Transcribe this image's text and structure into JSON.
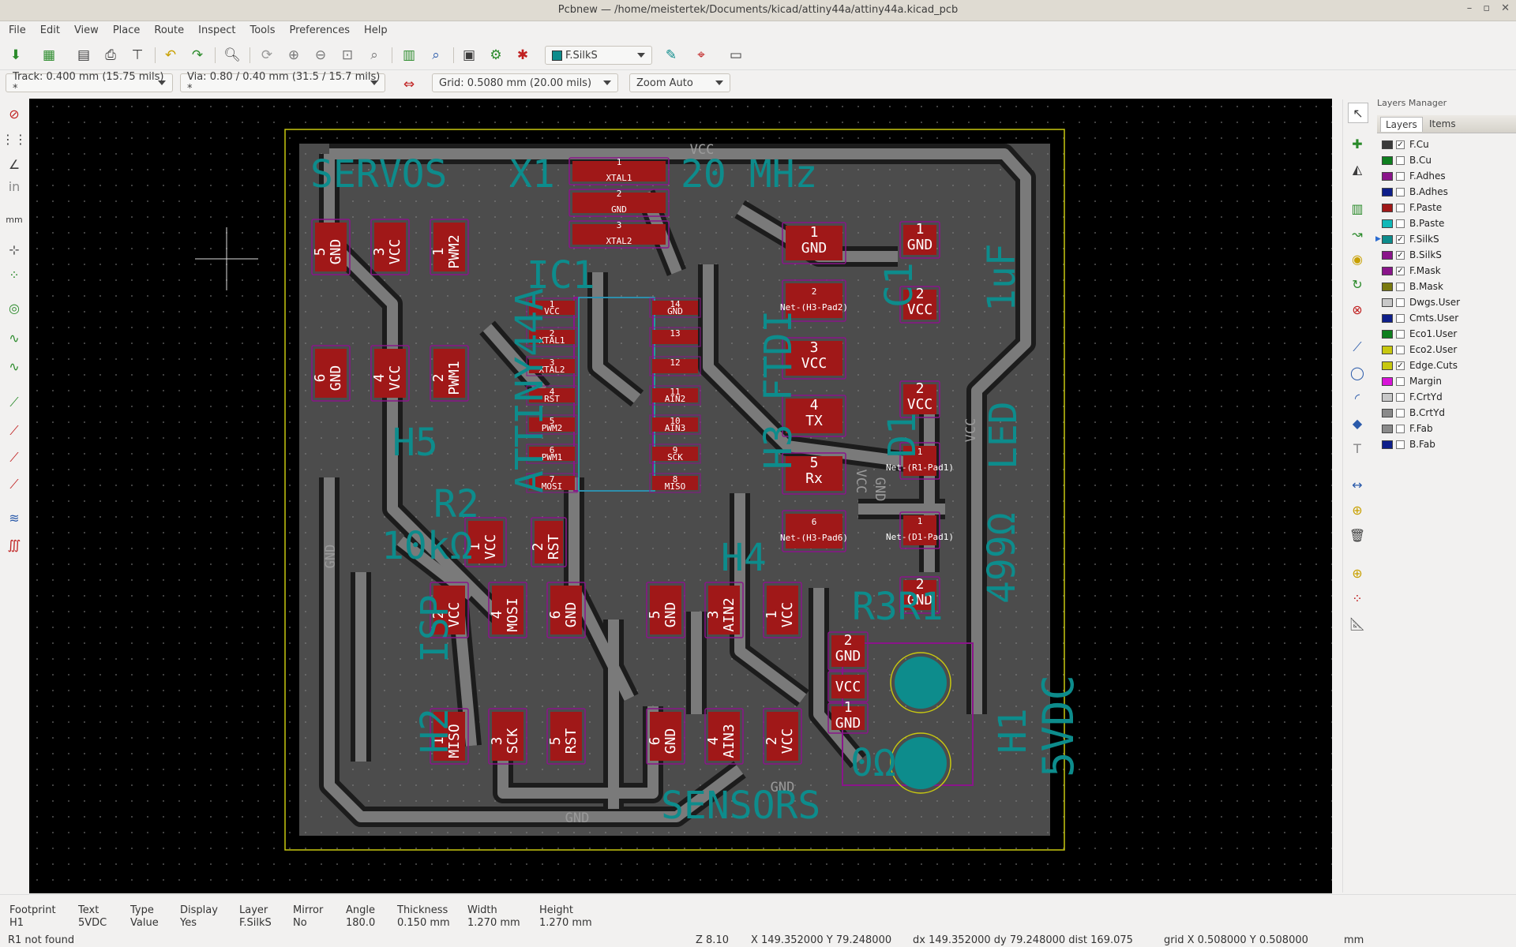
{
  "window": {
    "title": "Pcbnew — /home/meistertek/Documents/kicad/attiny44a/attiny44a.kicad_pcb",
    "min": "–",
    "max": "▫",
    "close": "✕"
  },
  "menu": [
    "File",
    "Edit",
    "View",
    "Place",
    "Route",
    "Inspect",
    "Tools",
    "Preferences",
    "Help"
  ],
  "toolbar": {
    "layer_select": "F.SilkS"
  },
  "options": {
    "track": "Track: 0.400 mm (15.75 mils) *",
    "via": "Via: 0.80 / 0.40 mm (31.5 / 15.7 mils) *",
    "grid": "Grid: 0.5080 mm (20.00 mils)",
    "zoom": "Zoom Auto"
  },
  "board": {
    "silkscreen": [
      "SERVOS",
      "X1",
      "20 MHz",
      "IC1",
      "ATTINY44A",
      "H3 FTDI",
      "C1",
      "1uF",
      "D1",
      "LED",
      "H5",
      "R2",
      "10kΩ",
      "ISP",
      "H2",
      "H4",
      "R3R1",
      "499Ω",
      "0Ω",
      "H1",
      "5VDC",
      "SENSORS"
    ],
    "copper_labels": [
      "VCC",
      "GND",
      "GND",
      "GND",
      "GND",
      "VCC",
      "VCC"
    ],
    "pads": [
      [
        "5",
        "GND"
      ],
      [
        "3",
        "VCC"
      ],
      [
        "1",
        "PWM2"
      ],
      [
        "6",
        "GND"
      ],
      [
        "4",
        "VCC"
      ],
      [
        "2",
        "PWM1"
      ],
      [
        "1",
        "XTAL1"
      ],
      [
        "2",
        "GND"
      ],
      [
        "3",
        "XTAL2"
      ],
      [
        "1",
        "GND"
      ],
      [
        "2",
        "Net-(H3-Pad2)"
      ],
      [
        "3",
        "VCC"
      ],
      [
        "4",
        "TX"
      ],
      [
        "5",
        "Rx"
      ],
      [
        "6",
        "Net-(H3-Pad6)"
      ],
      [
        "1",
        "GND"
      ],
      [
        "2",
        "VCC"
      ],
      [
        "2",
        "VCC"
      ],
      [
        "1",
        "Net-(R1-Pad1)"
      ],
      [
        "1",
        "Net-(D1-Pad1)"
      ],
      [
        "2",
        "GND"
      ],
      [
        "1",
        "VCC"
      ],
      [
        "2",
        "RST"
      ],
      [
        "2",
        "VCC"
      ],
      [
        "4",
        "MOSI"
      ],
      [
        "6",
        "GND"
      ],
      [
        "1",
        "MISO"
      ],
      [
        "3",
        "SCK"
      ],
      [
        "5",
        "RST"
      ],
      [
        "5",
        "GND"
      ],
      [
        "3",
        "AIN2"
      ],
      [
        "1",
        "VCC"
      ],
      [
        "6",
        "GND"
      ],
      [
        "4",
        "AIN3"
      ],
      [
        "2",
        "VCC"
      ],
      [
        "2",
        "GND"
      ],
      [
        "VCC",
        ""
      ],
      [
        "1",
        "GND"
      ]
    ],
    "ic_pins_left": [
      [
        "1",
        "VCC"
      ],
      [
        "2",
        "XTAL1"
      ],
      [
        "3",
        "XTAL2"
      ],
      [
        "4",
        "RST"
      ],
      [
        "5",
        "PWM2"
      ],
      [
        "6",
        "PWM1"
      ],
      [
        "7",
        "MOSI"
      ]
    ],
    "ic_pins_right": [
      [
        "14",
        "GND"
      ],
      [
        "13",
        ""
      ],
      [
        "12",
        ""
      ],
      [
        "11",
        "AIN2"
      ],
      [
        "10",
        "AIN3"
      ],
      [
        "9",
        "SCK"
      ],
      [
        "8",
        "MISO"
      ]
    ]
  },
  "layers_manager": {
    "title": "Layers Manager",
    "tabs": [
      "Layers",
      "Items"
    ],
    "layers": [
      {
        "name": "F.Cu",
        "color": "#3a3a3a",
        "checked": true
      },
      {
        "name": "B.Cu",
        "color": "#0f7f1f",
        "checked": false
      },
      {
        "name": "F.Adhes",
        "color": "#8a158a",
        "checked": false
      },
      {
        "name": "B.Adhes",
        "color": "#0f1f8a",
        "checked": false
      },
      {
        "name": "F.Paste",
        "color": "#a01818",
        "checked": false
      },
      {
        "name": "B.Paste",
        "color": "#10b8b8",
        "checked": false
      },
      {
        "name": "F.SilkS",
        "color": "#0d8c8c",
        "checked": true,
        "selected": true
      },
      {
        "name": "B.SilkS",
        "color": "#8a158a",
        "checked": true
      },
      {
        "name": "F.Mask",
        "color": "#8a158a",
        "checked": true
      },
      {
        "name": "B.Mask",
        "color": "#7a7a10",
        "checked": false
      },
      {
        "name": "Dwgs.User",
        "color": "#c8c8c8",
        "checked": false
      },
      {
        "name": "Cmts.User",
        "color": "#0f1f8a",
        "checked": false
      },
      {
        "name": "Eco1.User",
        "color": "#0f7f1f",
        "checked": false
      },
      {
        "name": "Eco2.User",
        "color": "#c8c810",
        "checked": false
      },
      {
        "name": "Edge.Cuts",
        "color": "#c8c810",
        "checked": true
      },
      {
        "name": "Margin",
        "color": "#d815d8",
        "checked": false
      },
      {
        "name": "F.CrtYd",
        "color": "#c8c8c8",
        "checked": false
      },
      {
        "name": "B.CrtYd",
        "color": "#8a8a8a",
        "checked": false
      },
      {
        "name": "F.Fab",
        "color": "#8a8a8a",
        "checked": false
      },
      {
        "name": "B.Fab",
        "color": "#0f1f8a",
        "checked": false
      }
    ]
  },
  "message_panel": [
    {
      "label": "Footprint",
      "value": "H1"
    },
    {
      "label": "Text",
      "value": "5VDC"
    },
    {
      "label": "Type",
      "value": "Value"
    },
    {
      "label": "Display",
      "value": "Yes"
    },
    {
      "label": "Layer",
      "value": "F.SilkS"
    },
    {
      "label": "Mirror",
      "value": "No"
    },
    {
      "label": "Angle",
      "value": "180.0"
    },
    {
      "label": "Thickness",
      "value": "0.150 mm"
    },
    {
      "label": "Width",
      "value": "1.270 mm"
    },
    {
      "label": "Height",
      "value": "1.270 mm"
    }
  ],
  "status": {
    "message": "R1 not found",
    "zoom": "Z 8.10",
    "xy": "X 149.352000  Y 79.248000",
    "dxy": "dx 149.352000  dy 79.248000  dist 169.075",
    "grid": "grid X 0.508000  Y 0.508000",
    "units": "mm"
  }
}
